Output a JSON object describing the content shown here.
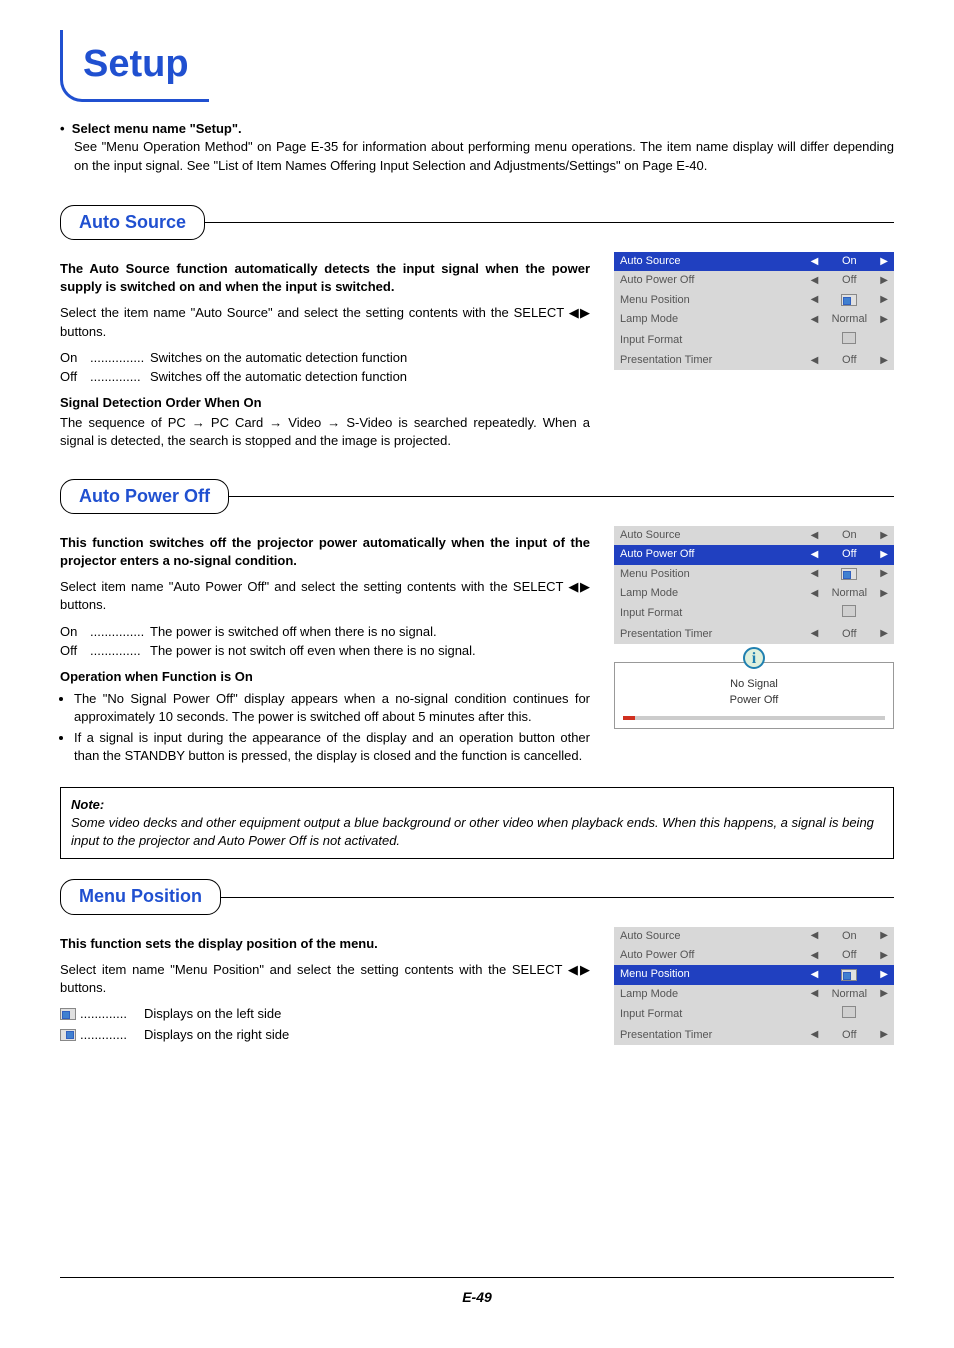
{
  "page_title": "Setup",
  "page_number": "E-49",
  "intro": {
    "bullet_label": "Select menu name \"Setup\".",
    "body": "See \"Menu Operation Method\" on Page E-35 for information about performing menu operations. The item name display will differ depending on the input signal. See \"List of Item Names Offering Input Selection and Adjustments/Settings\" on Page E-40."
  },
  "sections": {
    "auto_source": {
      "heading": "Auto Source",
      "summary_bold": "The Auto Source function automatically detects the input signal when the power supply is switched on and when the input is switched.",
      "instruction": "Select the item name \"Auto Source\" and select the setting contents with the SELECT ◀▶ buttons.",
      "defs": [
        {
          "key": "On",
          "val": "Switches on the automatic detection function"
        },
        {
          "key": "Off",
          "val": "Switches off the automatic detection function"
        }
      ],
      "sub_heading": "Signal Detection Order When On",
      "sub_body": "The sequence of PC → PC Card → Video → S-Video is searched repeatedly. When a signal is detected, the search is stopped and the image is projected."
    },
    "auto_power_off": {
      "heading": "Auto Power Off",
      "summary_bold": "This function switches off the projector power automatically when the input of the projector enters a no-signal condition.",
      "instruction": "Select item name \"Auto Power Off\" and select the setting contents with the SELECT ◀▶ buttons.",
      "defs": [
        {
          "key": "On",
          "val": "The power is switched off when there is no signal."
        },
        {
          "key": "Off",
          "val": "The power is not switch off even when there is no signal."
        }
      ],
      "op_heading": "Operation when Function is On",
      "op_items": [
        "The \"No Signal Power Off\" display appears when a no-signal condition continues for approximately 10 seconds. The power is switched off about 5 minutes after this.",
        "If a signal is input during the appearance of the display and an operation button other than the STANDBY button is pressed, the display is closed and the function is cancelled."
      ],
      "osd_msg1": "No Signal",
      "osd_msg2": "Power Off"
    },
    "menu_position": {
      "heading": "Menu Position",
      "summary_bold": "This function sets the display position of the menu.",
      "instruction": "Select item name \"Menu Position\" and select the setting contents with the SELECT ◀▶ buttons.",
      "defs": [
        {
          "val": "Displays on the left side"
        },
        {
          "val": "Displays on the right side"
        }
      ]
    }
  },
  "note": {
    "label": "Note:",
    "body": "Some video decks and other equipment output a blue background or other video when playback ends. When this happens, a signal is being input to the projector and Auto Power Off is not activated."
  },
  "menu": {
    "items": [
      {
        "label": "Auto Source",
        "value": "On",
        "left": true,
        "right": true
      },
      {
        "label": "Auto Power Off",
        "value": "Off",
        "left": true,
        "right": true
      },
      {
        "label": "Menu Position",
        "value": "POS",
        "left": true,
        "right": true
      },
      {
        "label": "Lamp Mode",
        "value": "Normal",
        "left": true,
        "right": true
      },
      {
        "label": "Input Format",
        "value": "RET",
        "left": false,
        "right": false
      },
      {
        "label": "Presentation Timer",
        "value": "Off",
        "left": true,
        "right": true
      }
    ]
  }
}
